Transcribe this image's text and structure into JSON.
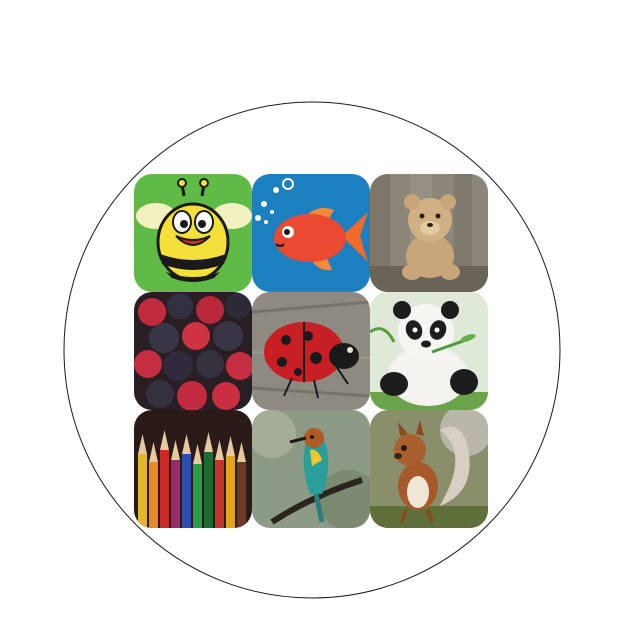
{
  "colors": {
    "background": "#ffffff",
    "circle_stroke": "#1a1a1a",
    "bee_bg": "#5fba46",
    "fish_bg": "#1c7fbf",
    "teddy_bg": "#8c8678",
    "ladybug_bg": "#8d8a82",
    "panda_bg": "#dfe9d8",
    "squirrel_bg": "#8a8f6b"
  },
  "grid": {
    "rows": 3,
    "columns": 3,
    "tiles": [
      {
        "icon": "cartoon-bee-icon"
      },
      {
        "icon": "cartoon-fish-icon"
      },
      {
        "icon": "teddy-bear-icon"
      },
      {
        "icon": "berries-icon"
      },
      {
        "icon": "ladybug-icon"
      },
      {
        "icon": "panda-icon"
      },
      {
        "icon": "colored-pencils-icon"
      },
      {
        "icon": "bee-eater-bird-icon"
      },
      {
        "icon": "squirrel-icon"
      }
    ]
  }
}
